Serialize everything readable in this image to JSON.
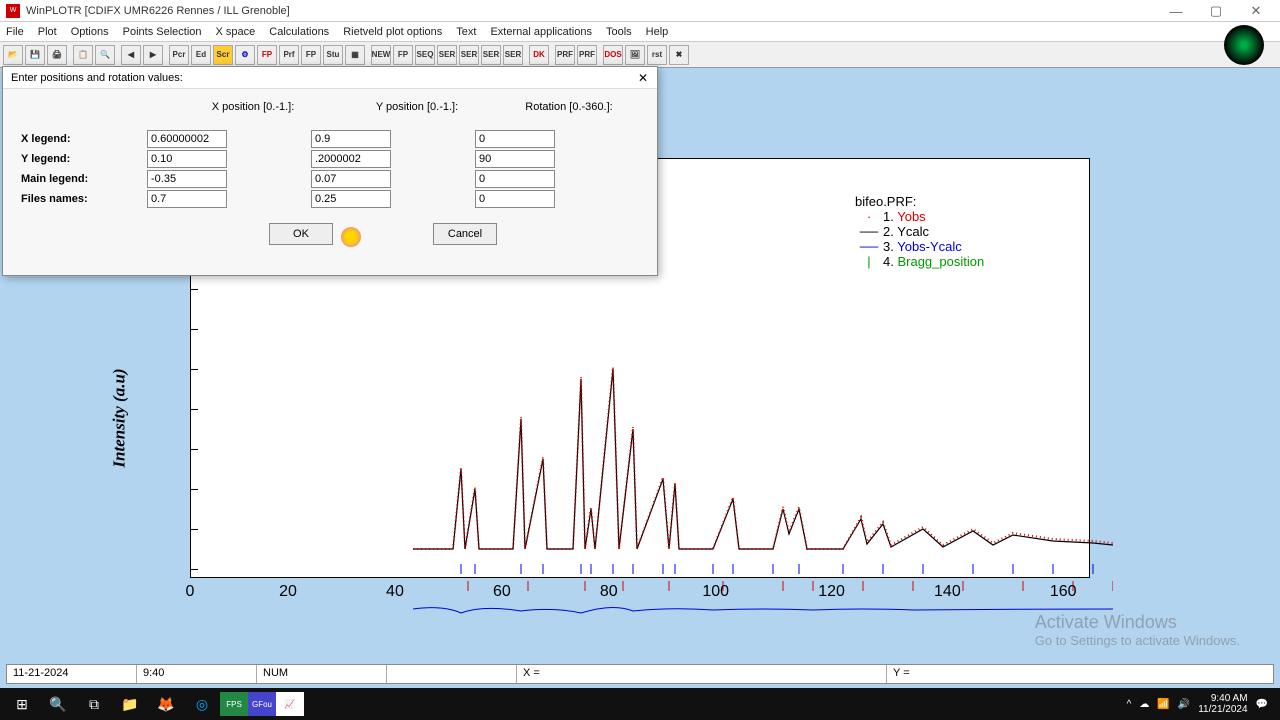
{
  "window": {
    "title": "WinPLOTR [CDIFX UMR6226 Rennes / ILL Grenoble]"
  },
  "menu": [
    "File",
    "Plot",
    "Options",
    "Points Selection",
    "X space",
    "Calculations",
    "Rietveld plot options",
    "Text",
    "External applications",
    "Tools",
    "Help"
  ],
  "dialog": {
    "title": "Enter positions and rotation values:",
    "headers": {
      "blank": "",
      "xpos": "X position [0.-1.]:",
      "ypos": "Y position [0.-1.]:",
      "rot": "Rotation [0.-360.]:"
    },
    "rows": [
      {
        "label": "X legend:",
        "x": "0.60000002",
        "y": "0.9",
        "r": "0"
      },
      {
        "label": "Y legend:",
        "x": "0.10",
        "y": ".2000002",
        "r": "90"
      },
      {
        "label": "Main legend:",
        "x": "-0.35",
        "y": "0.07",
        "r": "0"
      },
      {
        "label": "Files names:",
        "x": "0.7",
        "y": "0.25",
        "r": "0"
      }
    ],
    "ok": "OK",
    "cancel": "Cancel"
  },
  "plot": {
    "ylabel": "Intensity (a.u)",
    "xticks": [
      "0",
      "20",
      "40",
      "60",
      "80",
      "100",
      "120",
      "140",
      "160"
    ],
    "legend_title": "bifeo.PRF:",
    "legend": [
      {
        "n": "1.",
        "t": "Yobs",
        "c": "c-red",
        "m": "·"
      },
      {
        "n": "2.",
        "t": "Ycalc",
        "c": "c-blk",
        "m": "—"
      },
      {
        "n": "3.",
        "t": "Yobs-Ycalc",
        "c": "c-blu",
        "m": "—"
      },
      {
        "n": "4.",
        "t": "Bragg_position",
        "c": "c-grn",
        "m": "|"
      }
    ]
  },
  "status": {
    "date": "11-21-2024",
    "time": "9:40",
    "num": "NUM",
    "x": "X =",
    "y": "Y ="
  },
  "watermark": {
    "t1": "Activate Windows",
    "t2": "Go to Settings to activate Windows."
  },
  "tray": {
    "time": "9:40 AM",
    "date": "11/21/2024"
  },
  "chart_data": {
    "type": "line",
    "title": "bifeo.PRF",
    "xlabel": "",
    "ylabel": "Intensity (a.u)",
    "xlim": [
      0,
      160
    ],
    "series": [
      {
        "name": "Yobs",
        "style": "points",
        "color": "#d00"
      },
      {
        "name": "Ycalc",
        "style": "line",
        "color": "#000"
      },
      {
        "name": "Yobs-Ycalc",
        "style": "line",
        "color": "#00d"
      },
      {
        "name": "Bragg_position",
        "style": "ticks",
        "color": "#090"
      }
    ],
    "note": "Powder diffraction Rietveld plot; peaks between ~18 and ~135 on x-axis; bragg tick rows at two y-offsets; difference curve near baseline."
  }
}
